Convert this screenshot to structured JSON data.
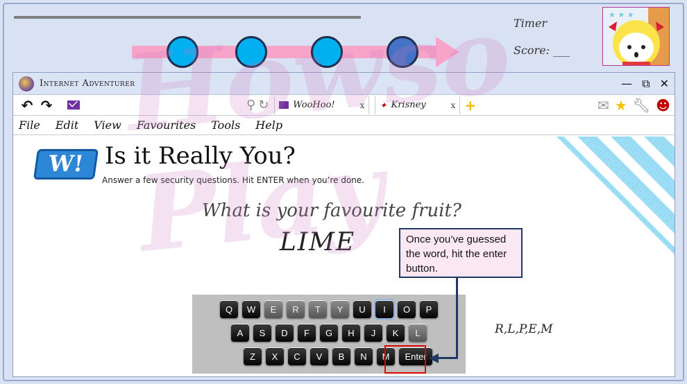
{
  "lesson": {
    "timer_label": "Timer",
    "score_label": "Score: ___",
    "watermark": "Howso\nPlay"
  },
  "browser": {
    "app_title": "Internet Adventurer",
    "window_controls": {
      "minimize": "—",
      "restore": "⧉",
      "close": "✕"
    },
    "nav": {
      "back": "↶",
      "forward": "↷"
    },
    "tabs": [
      {
        "label": "WooHoo!",
        "close": "x"
      },
      {
        "label": "Krisney",
        "close": "x"
      }
    ],
    "new_tab": "+",
    "menu": [
      "File",
      "Edit",
      "View",
      "Favourites",
      "Tools",
      "Help"
    ]
  },
  "page": {
    "logo_text": "W!",
    "title": "Is it Really You?",
    "subtitle": "Answer a few security questions. Hit ENTER when you’re done.",
    "question": "What is your favourite fruit?",
    "answer": "LIME",
    "used_letters": "R,L,P,E,M",
    "callout": "Once you’ve guessed the word, hit the enter button."
  },
  "keyboard": {
    "row1": [
      "Q",
      "W",
      "E",
      "R",
      "T",
      "Y",
      "U",
      "I",
      "O",
      "P"
    ],
    "row2": [
      "A",
      "S",
      "D",
      "F",
      "G",
      "H",
      "J",
      "K",
      "L"
    ],
    "row3": [
      "Z",
      "X",
      "C",
      "V",
      "B",
      "N",
      "M"
    ],
    "enter": "Enter"
  },
  "colors": {
    "accent": "#00b0f0",
    "active_step": "#4472c4",
    "arrow": "#f6a5c9",
    "highlight": "#e00000"
  }
}
